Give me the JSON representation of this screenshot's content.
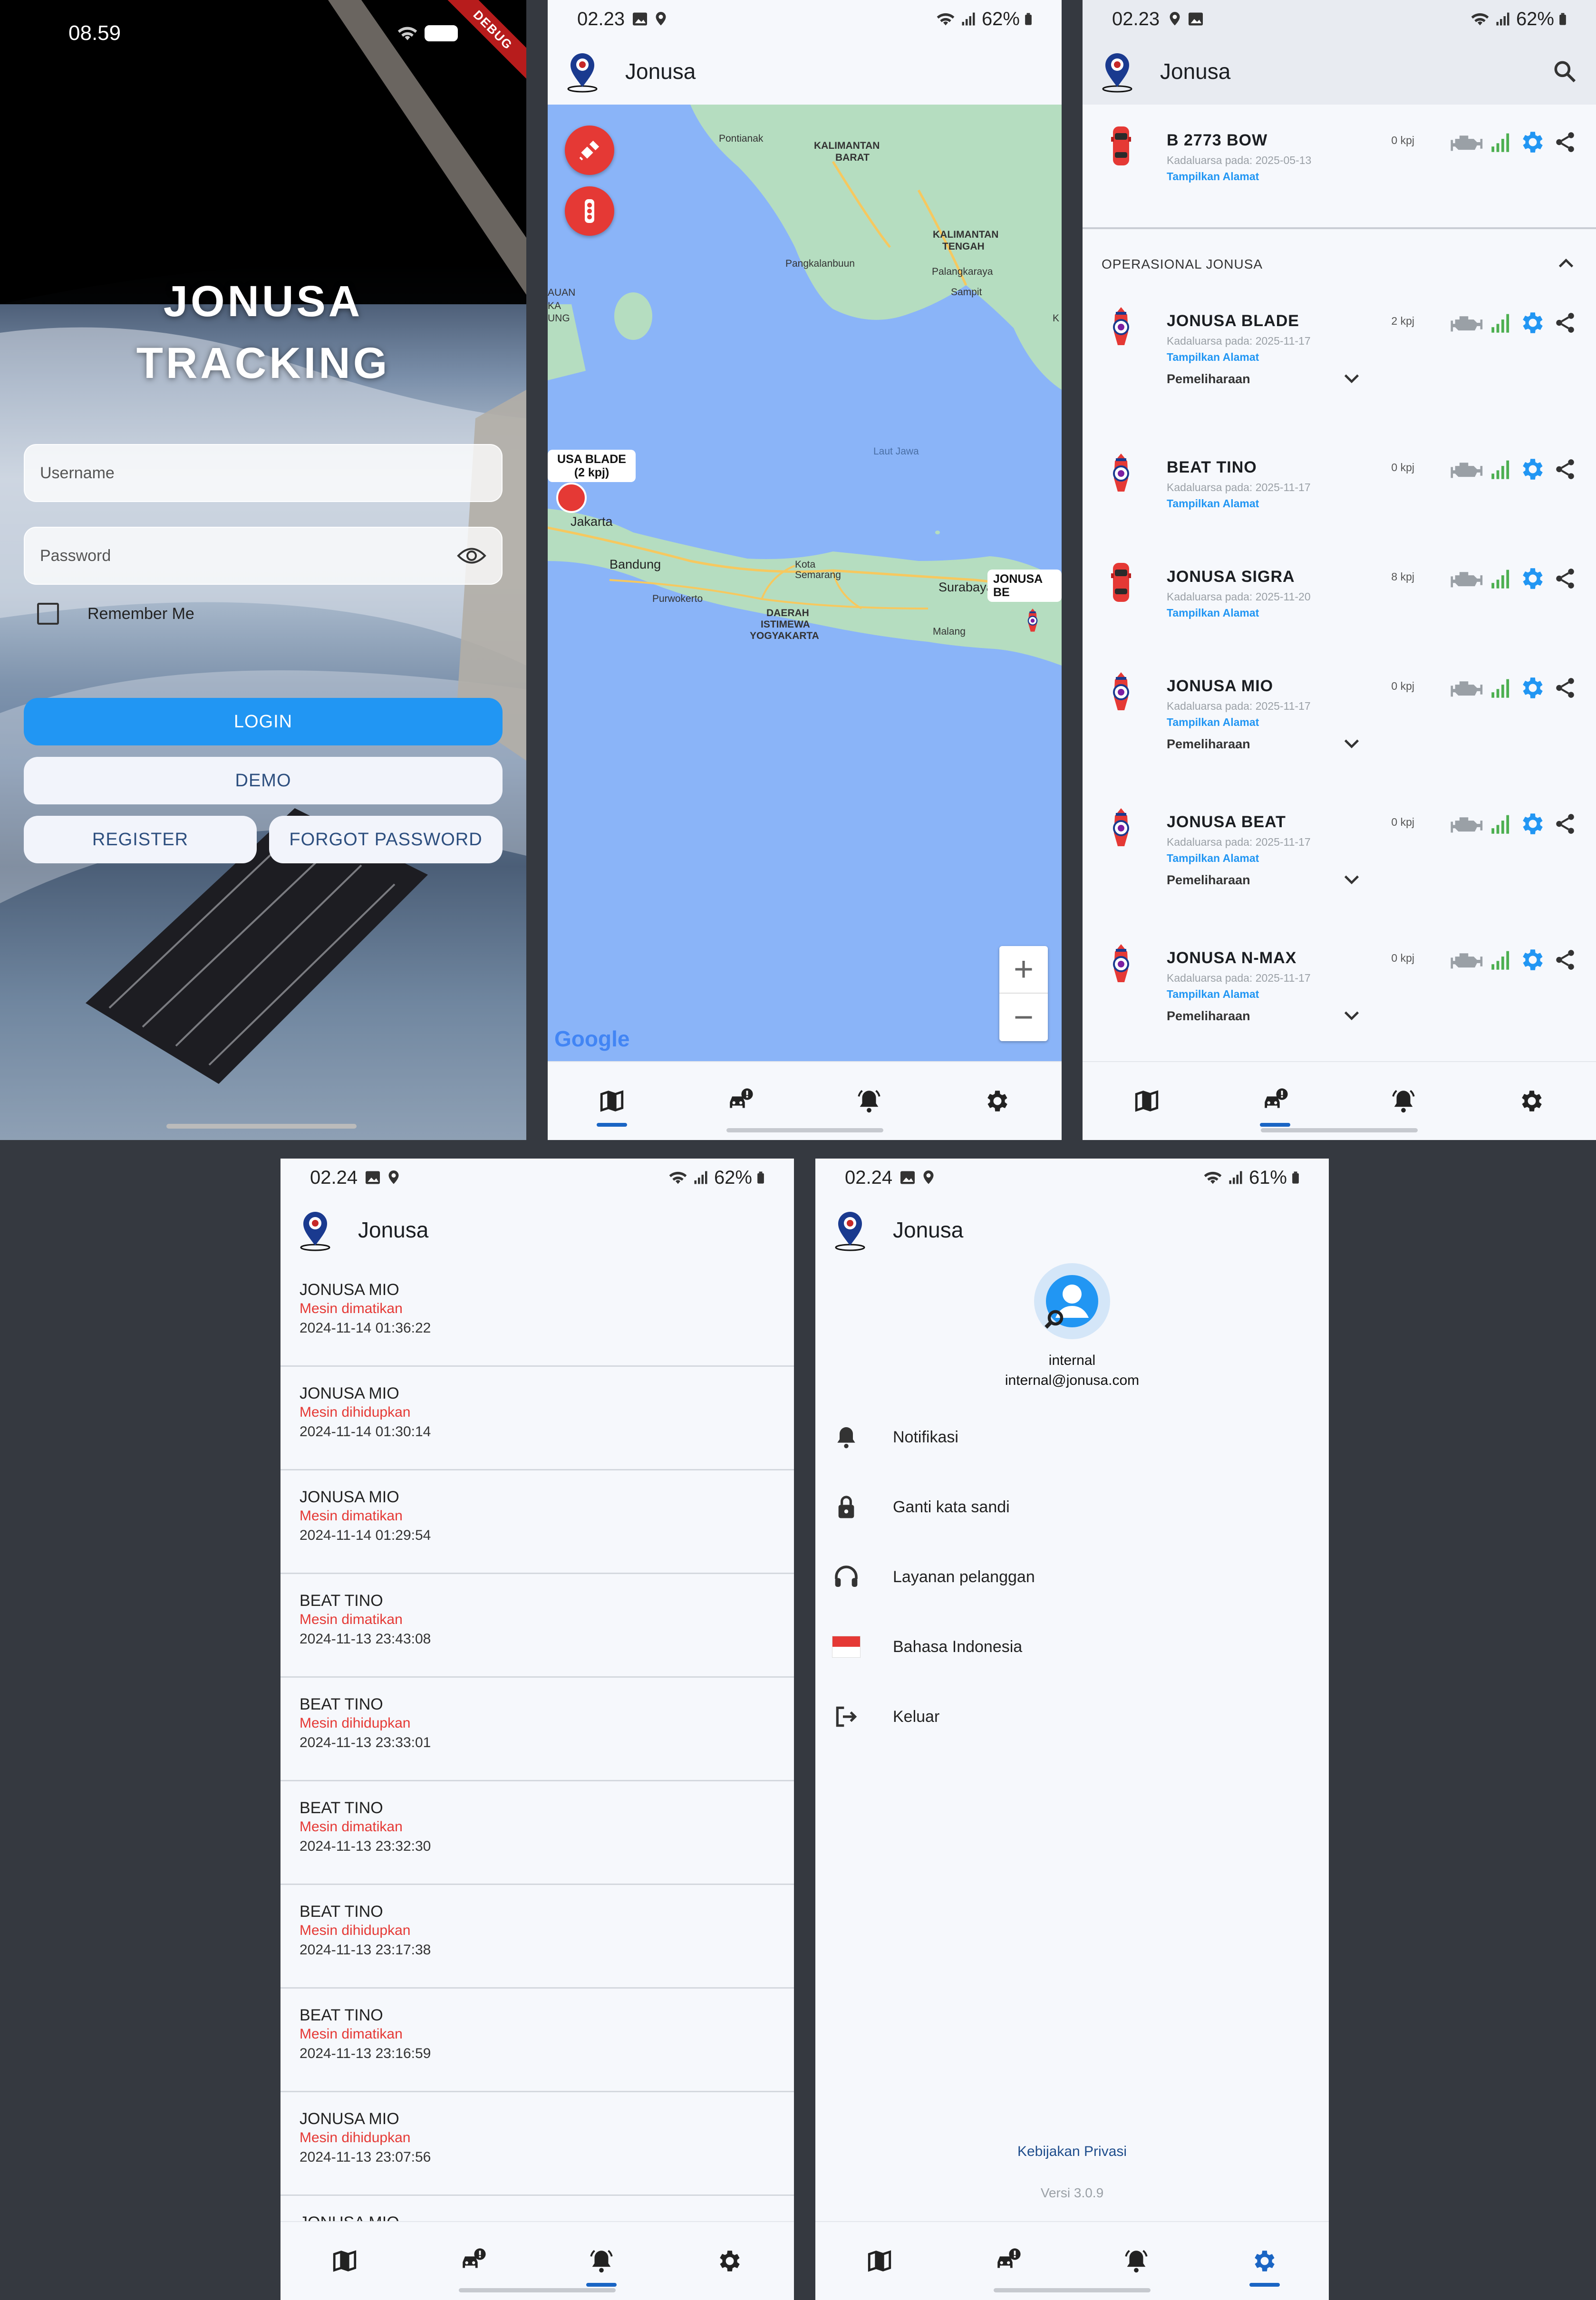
{
  "login": {
    "time": "08.59",
    "debug_badge": "DEBUG",
    "title_line1": "JONUSA",
    "title_line2": "TRACKING",
    "username_placeholder": "Username",
    "password_placeholder": "Password",
    "remember_label": "Remember Me",
    "login_label": "LOGIN",
    "demo_label": "DEMO",
    "register_label": "REGISTER",
    "forgot_label": "FORGOT PASSWORD"
  },
  "map_screen": {
    "status_time": "02.23",
    "battery": "62%",
    "app_title": "Jonusa",
    "labels": {
      "pontianak": "Pontianak",
      "kalbar1": "KALIMANTAN",
      "kalbar2": "BARAT",
      "kalteng1": "KALIMANTAN",
      "kalteng2": "TENGAH",
      "palangkaraya": "Palangkaraya",
      "sampit": "Sampit",
      "pangkalanbuun": "Pangkalanbuun",
      "laut_jawa": "Laut Jawa",
      "jakarta": "Jakarta",
      "bandung": "Bandung",
      "kota": "Kota",
      "semarang": "Semarang",
      "purwokerto": "Purwokerto",
      "diy1": "DAERAH",
      "diy2": "ISTIMEWA",
      "diy3": "YOGYAKARTA",
      "surabaya": "Surabaya",
      "malang": "Malang",
      "left_edge1": "AUAN",
      "left_edge2": "KA",
      "left_edge3": "UNG",
      "right_edge": "K"
    },
    "marker_blade": "USA BLADE (2 kpj)",
    "marker_east": "JONUSA BE",
    "google": "Google",
    "zoom_in": "+",
    "zoom_out": "−"
  },
  "list_screen": {
    "status_time": "02.23",
    "battery": "62%",
    "app_title": "Jonusa",
    "section_title": "OPERASIONAL JONUSA",
    "expiry_prefix": "Kadaluarsa pada:",
    "show_address": "Tampilkan Alamat",
    "maintenance": "Pemeliharaan",
    "top_vehicle": {
      "name": "B 2773 BOW",
      "speed": "0 kpj",
      "expiry": "Kadaluarsa pada: 2025-05-13",
      "addr": "Tampilkan Alamat"
    },
    "vehicles": [
      {
        "name": "JONUSA BLADE",
        "speed": "2 kpj",
        "expiry": "Kadaluarsa pada: 2025-11-17",
        "addr": "Tampilkan Alamat",
        "maint": "Pemeliharaan"
      },
      {
        "name": "BEAT TINO",
        "speed": "0 kpj",
        "expiry": "Kadaluarsa pada: 2025-11-17",
        "addr": "Tampilkan Alamat",
        "maint": ""
      },
      {
        "name": "JONUSA SIGRA",
        "speed": "8 kpj",
        "expiry": "Kadaluarsa pada: 2025-11-20",
        "addr": "Tampilkan Alamat",
        "maint": ""
      },
      {
        "name": "JONUSA MIO",
        "speed": "0 kpj",
        "expiry": "Kadaluarsa pada: 2025-11-17",
        "addr": "Tampilkan Alamat",
        "maint": "Pemeliharaan"
      },
      {
        "name": "JONUSA BEAT",
        "speed": "0 kpj",
        "expiry": "Kadaluarsa pada: 2025-11-17",
        "addr": "Tampilkan Alamat",
        "maint": "Pemeliharaan"
      },
      {
        "name": "JONUSA N-MAX",
        "speed": "0 kpj",
        "expiry": "Kadaluarsa pada: 2025-11-17",
        "addr": "Tampilkan Alamat",
        "maint": "Pemeliharaan"
      }
    ]
  },
  "notif_screen": {
    "status_time": "02.24",
    "battery": "62%",
    "app_title": "Jonusa",
    "items": [
      {
        "title": "JONUSA MIO",
        "status": "Mesin dimatikan",
        "time": "2024-11-14 01:36:22"
      },
      {
        "title": "JONUSA MIO",
        "status": "Mesin dihidupkan",
        "time": "2024-11-14 01:30:14"
      },
      {
        "title": "JONUSA MIO",
        "status": "Mesin dimatikan",
        "time": "2024-11-14 01:29:54"
      },
      {
        "title": "BEAT TINO",
        "status": "Mesin dimatikan",
        "time": "2024-11-13 23:43:08"
      },
      {
        "title": "BEAT TINO",
        "status": "Mesin dihidupkan",
        "time": "2024-11-13 23:33:01"
      },
      {
        "title": "BEAT TINO",
        "status": "Mesin dimatikan",
        "time": "2024-11-13 23:32:30"
      },
      {
        "title": "BEAT TINO",
        "status": "Mesin dihidupkan",
        "time": "2024-11-13 23:17:38"
      },
      {
        "title": "BEAT TINO",
        "status": "Mesin dimatikan",
        "time": "2024-11-13 23:16:59"
      },
      {
        "title": "JONUSA MIO",
        "status": "Mesin dihidupkan",
        "time": "2024-11-13 23:07:56"
      },
      {
        "title": "JONUSA MIO",
        "status": "",
        "time": ""
      }
    ]
  },
  "settings_screen": {
    "status_time": "02.24",
    "battery": "61%",
    "app_title": "Jonusa",
    "user_name": "internal",
    "user_email": "internal@jonusa.com",
    "items": [
      {
        "label": "Notifikasi",
        "icon": "bell-icon"
      },
      {
        "label": "Ganti kata sandi",
        "icon": "lock-icon"
      },
      {
        "label": "Layanan pelanggan",
        "icon": "headset-icon"
      },
      {
        "label": "Bahasa Indonesia",
        "icon": "indonesia-flag-icon"
      },
      {
        "label": "Keluar",
        "icon": "logout-icon"
      }
    ],
    "privacy": "Kebijakan Privasi",
    "version": "Versi 3.0.9"
  },
  "nav": {
    "items": [
      {
        "icon": "map-icon",
        "label": ""
      },
      {
        "icon": "vehicle-alert-icon",
        "label": ""
      },
      {
        "icon": "bell-ring-icon",
        "label": ""
      },
      {
        "icon": "gear-icon",
        "label": ""
      }
    ],
    "accent": "#1a65c4"
  },
  "colors": {
    "primary_blue": "#2196f3",
    "danger_red": "#e53935",
    "signal_green": "#4caf50",
    "sea_blue": "#8ab4f8",
    "land_green": "#b5ddc0"
  }
}
